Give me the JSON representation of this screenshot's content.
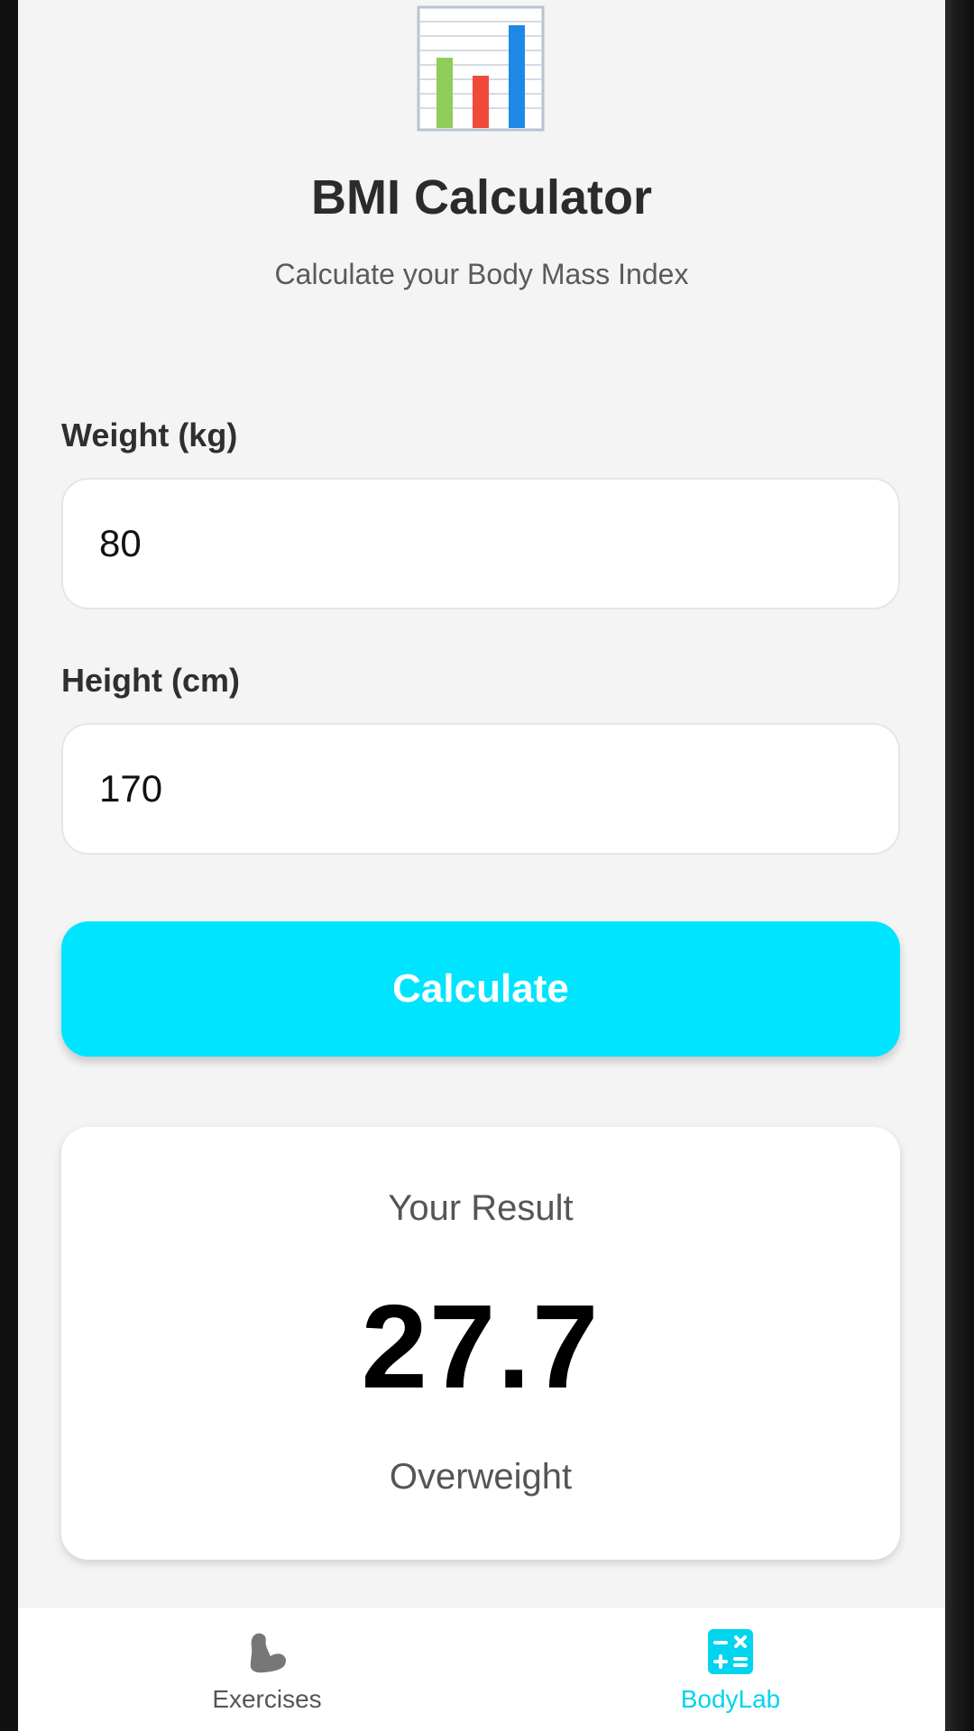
{
  "header": {
    "icon": "bar-chart-icon",
    "title": "BMI Calculator",
    "subtitle": "Calculate your Body Mass Index"
  },
  "form": {
    "weight_label": "Weight (kg)",
    "weight_value": "80",
    "height_label": "Height (cm)",
    "height_value": "170",
    "calculate_label": "Calculate"
  },
  "result": {
    "title": "Your Result",
    "value": "27.7",
    "category": "Overweight"
  },
  "bottom_nav": {
    "items": [
      {
        "label": "Exercises",
        "icon": "flexed-biceps-icon",
        "active": false
      },
      {
        "label": "BodyLab",
        "icon": "calculator-icon",
        "active": true
      }
    ]
  },
  "colors": {
    "accent": "#00e5ff",
    "nav_active": "#00d4ef",
    "background": "#f4f4f4"
  }
}
